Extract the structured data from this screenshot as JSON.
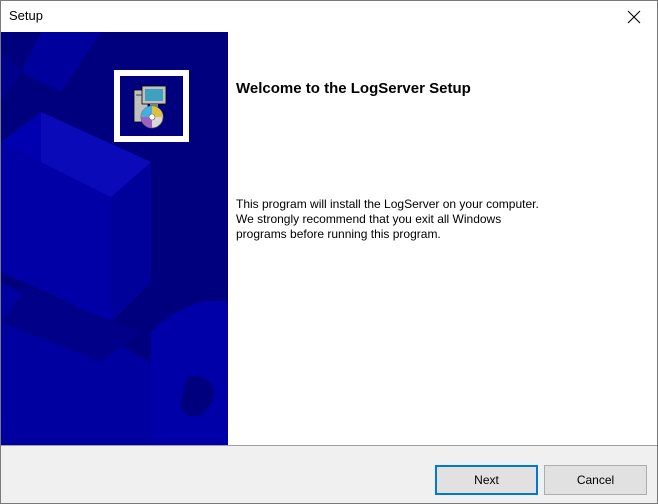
{
  "window": {
    "title": "Setup",
    "close_icon": "close-icon"
  },
  "welcome": {
    "heading": "Welcome to the LogServer Setup",
    "lines": [
      "This program will install the LogServer on your computer.",
      "We strongly recommend that you exit all Windows",
      "programs before running this program."
    ]
  },
  "buttons": {
    "next_label": "Next",
    "cancel_label": "Cancel"
  },
  "colors": {
    "side_panel": "#00007f",
    "accent": "#0078d7"
  },
  "icons": {
    "setup": "setup-installer-icon"
  }
}
